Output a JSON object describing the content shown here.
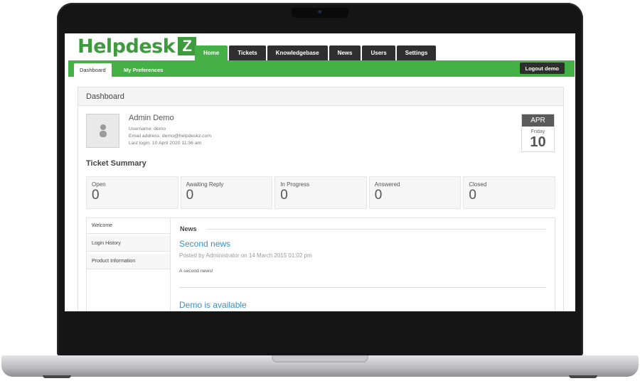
{
  "brand": {
    "logo_text": "Helpdesk",
    "logo_letter": "Z",
    "accent": "#45b045",
    "dark": "#2f2f2f",
    "link": "#3b8ec4"
  },
  "main_tabs": [
    {
      "label": "Home",
      "active": true
    },
    {
      "label": "Tickets"
    },
    {
      "label": "Knowledgebase"
    },
    {
      "label": "News"
    },
    {
      "label": "Users"
    },
    {
      "label": "Settings"
    }
  ],
  "sub_nav": {
    "dashboard": "Dashboard",
    "preferences": "My Preferences",
    "logout": "Logout  demo"
  },
  "panel": {
    "title": "Dashboard"
  },
  "user": {
    "name": "Admin Demo",
    "username": "Username: demo",
    "email": "Email address: demo@helpdeskz.com",
    "last_login": "Last login: 10 April 2020 11:36 am"
  },
  "date": {
    "month": "APR",
    "weekday": "Friday",
    "day": "10"
  },
  "ticket_summary": {
    "title": "Ticket Summary",
    "stats": [
      {
        "label": "Open",
        "value": "0"
      },
      {
        "label": "Awaiting Reply",
        "value": "0"
      },
      {
        "label": "In Progress",
        "value": "0"
      },
      {
        "label": "Answered",
        "value": "0"
      },
      {
        "label": "Closed",
        "value": "0"
      }
    ]
  },
  "side_menu": [
    "Welcome",
    "Login History",
    "Product Information"
  ],
  "news": {
    "heading": "News",
    "items": [
      {
        "title": "Second news",
        "meta": "Posted by Administrator on 14 March 2015 01:02 pm",
        "body": "A second news!"
      },
      {
        "title": "Demo is available"
      }
    ]
  }
}
